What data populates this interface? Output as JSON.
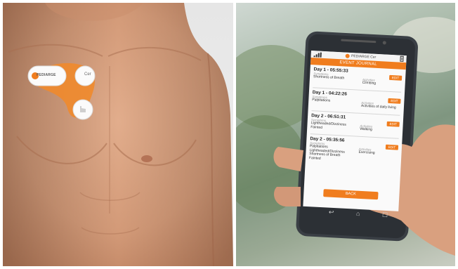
{
  "left_panel": {
    "device": {
      "brand": "PEDIARGE",
      "model": "Cer"
    }
  },
  "phone": {
    "app_name": "PEDIARGE Cer",
    "screen_title": "EVENT JOURNAL",
    "entries": [
      {
        "date": "Day 1 - 05:55:33",
        "symptoms_label": "Symptoms",
        "symptoms": "Shortness of Breath",
        "activities_label": "Activities",
        "activities": "Climbing",
        "edit_label": "EDIT"
      },
      {
        "date": "Day 1 - 04:22:26",
        "symptoms_label": "Symptoms",
        "symptoms": "Palpitations",
        "activities_label": "Activities",
        "activities": "Activities of daily living",
        "edit_label": "EDIT"
      },
      {
        "date": "Day 2 - 06:51:31",
        "symptoms_label": "Symptoms",
        "symptoms": "Lightheaded/Dizziness Fainted",
        "activities_label": "Activities",
        "activities": "Walking",
        "edit_label": "EDIT"
      },
      {
        "date": "Day 2 - 05:35:56",
        "symptoms_label": "Symptoms",
        "symptoms": "Palpitations Lightheaded/Dizziness Shortness of Breath Fainted",
        "activities_label": "Activities",
        "activities": "Exercising",
        "edit_label": "EDIT"
      }
    ],
    "back_label": "BACK",
    "nav_icons": [
      "back-icon",
      "home-icon",
      "recent-apps-icon"
    ]
  },
  "colors": {
    "accent": "#f07d1e",
    "skin": "#d9a07f",
    "phone_body": "#3a3f45"
  }
}
